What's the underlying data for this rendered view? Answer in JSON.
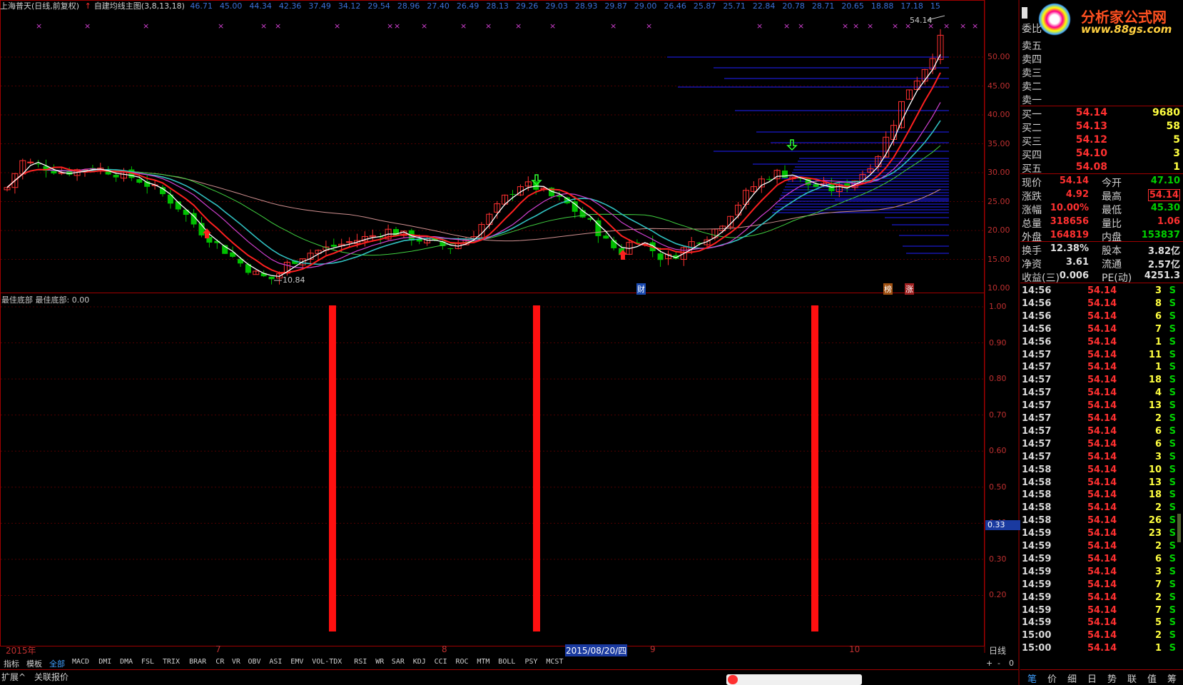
{
  "header": {
    "stock_name": "上海普天(日线,前复权)",
    "indicator_name": "自建均线主图(3,8,13,18)",
    "top_values": [
      "46.71",
      "45.00",
      "44.34",
      "42.36",
      "37.49",
      "34.12",
      "29.54",
      "28.96",
      "27.40",
      "26.49",
      "28.13",
      "29.26",
      "29.03",
      "28.93",
      "29.87",
      "29.00",
      "26.46",
      "25.87",
      "25.71",
      "22.84",
      "20.78",
      "28.71",
      "20.65",
      "18.88",
      "17.18",
      "15"
    ]
  },
  "main_chart": {
    "y_labels": [
      "50.00",
      "45.00",
      "40.00",
      "35.00",
      "30.00",
      "25.00",
      "20.00",
      "15.00",
      "10.00"
    ],
    "high_marker": "54.14",
    "low_marker": "10.84",
    "events": [
      "财",
      "榜",
      "涨"
    ]
  },
  "sub_chart": {
    "title": "最佳底部 最佳底部: 0.00",
    "y_labels": [
      "1.00",
      "0.90",
      "0.80",
      "0.70",
      "0.60",
      "0.50",
      "0.40",
      "0.30",
      "0.20"
    ],
    "current_value": "0.33",
    "signal_bars_count": 3
  },
  "x_axis": {
    "labels": [
      "2015年",
      "7",
      "8",
      "2015/08/20/四",
      "9",
      "10"
    ],
    "period": "日线"
  },
  "colors": {
    "up": "#ff3030",
    "down": "#00c000",
    "ma3": "#ffffff",
    "ma8": "#ff2020",
    "ma13": "#d040d0",
    "ma18": "#30c0c0",
    "long_ma1": "#40d040",
    "long_ma2": "#d09090",
    "volume_profile": "#2020ff",
    "signal_bar": "#ff1010"
  },
  "right_panel": {
    "logo_text": "分析家公式网",
    "logo_url": "www.88gs.com",
    "wei_label": "委比",
    "sell": [
      "卖五",
      "卖四",
      "卖三",
      "卖二",
      "卖一"
    ],
    "buy": [
      {
        "label": "买一",
        "price": "54.14",
        "vol": "9680"
      },
      {
        "label": "买二",
        "price": "54.13",
        "vol": "58"
      },
      {
        "label": "买三",
        "price": "54.12",
        "vol": "5"
      },
      {
        "label": "买四",
        "price": "54.10",
        "vol": "3"
      },
      {
        "label": "买五",
        "price": "54.08",
        "vol": "1"
      }
    ],
    "stats": [
      {
        "l1": "现价",
        "v1": "54.14",
        "l2": "今开",
        "v2": "47.10"
      },
      {
        "l1": "涨跌",
        "v1": "4.92",
        "l2": "最高",
        "v2": "54.14"
      },
      {
        "l1": "涨幅",
        "v1": "10.00%",
        "l2": "最低",
        "v2": "45.30"
      },
      {
        "l1": "总量",
        "v1": "318656",
        "l2": "量比",
        "v2": "1.06"
      },
      {
        "l1": "外盘",
        "v1": "164819",
        "l2": "内盘",
        "v2": "153837"
      }
    ],
    "stats2": [
      {
        "l1": "换手",
        "v1": "12.38%",
        "l2": "股本",
        "v2": "3.82亿"
      },
      {
        "l1": "净资",
        "v1": "3.61",
        "l2": "流通",
        "v2": "2.57亿"
      },
      {
        "l1": "收益(三)",
        "v1": "0.006",
        "l2": "PE(动)",
        "v2": "4251.3"
      }
    ],
    "ticks": [
      {
        "t": "14:56",
        "p": "54.14",
        "v": "3",
        "s": "S"
      },
      {
        "t": "14:56",
        "p": "54.14",
        "v": "8",
        "s": "S"
      },
      {
        "t": "14:56",
        "p": "54.14",
        "v": "6",
        "s": "S"
      },
      {
        "t": "14:56",
        "p": "54.14",
        "v": "7",
        "s": "S"
      },
      {
        "t": "14:56",
        "p": "54.14",
        "v": "1",
        "s": "S"
      },
      {
        "t": "14:57",
        "p": "54.14",
        "v": "11",
        "s": "S"
      },
      {
        "t": "14:57",
        "p": "54.14",
        "v": "1",
        "s": "S"
      },
      {
        "t": "14:57",
        "p": "54.14",
        "v": "18",
        "s": "S"
      },
      {
        "t": "14:57",
        "p": "54.14",
        "v": "4",
        "s": "S"
      },
      {
        "t": "14:57",
        "p": "54.14",
        "v": "13",
        "s": "S"
      },
      {
        "t": "14:57",
        "p": "54.14",
        "v": "2",
        "s": "S"
      },
      {
        "t": "14:57",
        "p": "54.14",
        "v": "6",
        "s": "S"
      },
      {
        "t": "14:57",
        "p": "54.14",
        "v": "6",
        "s": "S"
      },
      {
        "t": "14:57",
        "p": "54.14",
        "v": "3",
        "s": "S"
      },
      {
        "t": "14:58",
        "p": "54.14",
        "v": "10",
        "s": "S"
      },
      {
        "t": "14:58",
        "p": "54.14",
        "v": "13",
        "s": "S"
      },
      {
        "t": "14:58",
        "p": "54.14",
        "v": "18",
        "s": "S"
      },
      {
        "t": "14:58",
        "p": "54.14",
        "v": "2",
        "s": "S"
      },
      {
        "t": "14:58",
        "p": "54.14",
        "v": "26",
        "s": "S"
      },
      {
        "t": "14:59",
        "p": "54.14",
        "v": "23",
        "s": "S"
      },
      {
        "t": "14:59",
        "p": "54.14",
        "v": "2",
        "s": "S"
      },
      {
        "t": "14:59",
        "p": "54.14",
        "v": "6",
        "s": "S"
      },
      {
        "t": "14:59",
        "p": "54.14",
        "v": "3",
        "s": "S"
      },
      {
        "t": "14:59",
        "p": "54.14",
        "v": "7",
        "s": "S"
      },
      {
        "t": "14:59",
        "p": "54.14",
        "v": "2",
        "s": "S"
      },
      {
        "t": "14:59",
        "p": "54.14",
        "v": "7",
        "s": "S"
      },
      {
        "t": "14:59",
        "p": "54.14",
        "v": "5",
        "s": "S"
      },
      {
        "t": "15:00",
        "p": "54.14",
        "v": "2",
        "s": "S"
      },
      {
        "t": "15:00",
        "p": "54.14",
        "v": "1",
        "s": "S"
      }
    ],
    "bottom_tabs": [
      "笔",
      "价",
      "细",
      "日",
      "势",
      "联",
      "值",
      "筹"
    ]
  },
  "bottom_tabs": [
    "指标",
    "模板",
    "全部",
    "MACD",
    "DMI",
    "DMA",
    "FSL",
    "TRIX",
    "BRAR",
    "CR",
    "VR",
    "OBV",
    "ASI",
    "EMV",
    "VOL-TDX",
    "RSI",
    "WR",
    "SAR",
    "KDJ",
    "CCI",
    "ROC",
    "MTM",
    "BOLL",
    "PSY",
    "MCST"
  ],
  "bottom_right": [
    "+",
    "-",
    "0"
  ],
  "status_tabs": [
    "扩展^",
    "关联报价"
  ]
}
